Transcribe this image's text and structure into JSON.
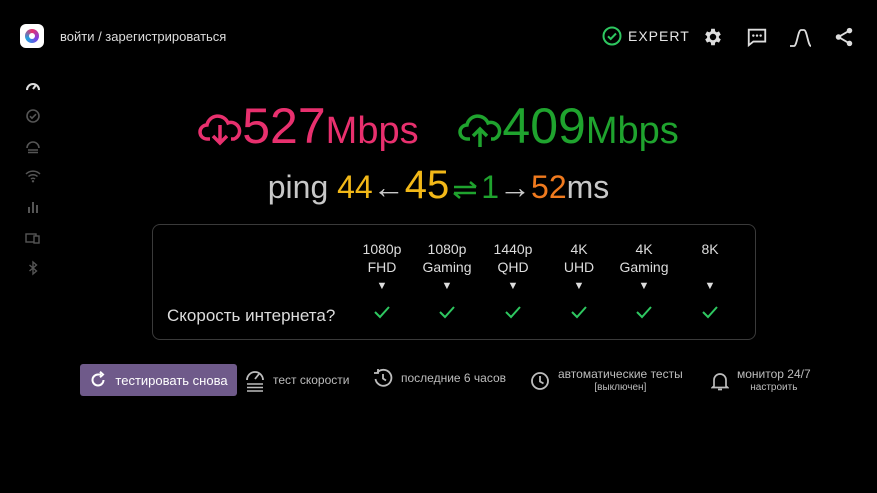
{
  "header": {
    "login_label": "войти / зарегистрироваться",
    "expert_label": "EXPERT",
    "icons": [
      "settings-icon",
      "comment-icon",
      "curve-icon",
      "share-icon"
    ]
  },
  "sidebar": {
    "items": [
      "speedometer-icon",
      "check-circle-icon",
      "speedtest-icon",
      "wifi-icon",
      "bar-chart-icon",
      "devices-icon",
      "bluetooth-icon"
    ]
  },
  "results": {
    "download_value": "527",
    "download_unit": "Mbps",
    "upload_value": "409",
    "upload_unit": "Mbps",
    "ping_label": "ping",
    "ping_low": "44",
    "ping_left_arrow": "←",
    "ping_main": "45",
    "ping_jitter": "1",
    "ping_right_arrow": "→",
    "ping_high": "52",
    "ping_unit": "ms"
  },
  "quality": {
    "question": "Скорость интернета?",
    "columns": [
      {
        "line1": "1080p",
        "line2": "FHD",
        "arrow": "▼",
        "status": "ok"
      },
      {
        "line1": "1080p",
        "line2": "Gaming",
        "arrow": "▼",
        "status": "ok"
      },
      {
        "line1": "1440p",
        "line2": "QHD",
        "arrow": "▼",
        "status": "ok"
      },
      {
        "line1": "4K",
        "line2": "UHD",
        "arrow": "▼",
        "status": "ok"
      },
      {
        "line1": "4K",
        "line2": "Gaming",
        "arrow": "▼",
        "status": "ok"
      },
      {
        "line1": "",
        "line2": "8K",
        "arrow": "▼",
        "status": "ok"
      }
    ]
  },
  "toolbar": {
    "retest_label": "тестировать снова",
    "speedtest_label": "тест скорости",
    "history_label": "последние 6 часов",
    "auto_label": "автоматические тесты",
    "auto_sub": "[выключен]",
    "monitor_label": "монитор 24/7",
    "monitor_sub": "настроить"
  },
  "colors": {
    "download": "#e8306e",
    "upload": "#1fa32e",
    "ping_text": "#c8c8c8",
    "ping_low": "#f2b818",
    "ping_main": "#f2b818",
    "ping_jitter": "#1fa32e",
    "ping_high": "#f07a1e",
    "check": "#2ec760",
    "button": "#6f5a8a"
  }
}
